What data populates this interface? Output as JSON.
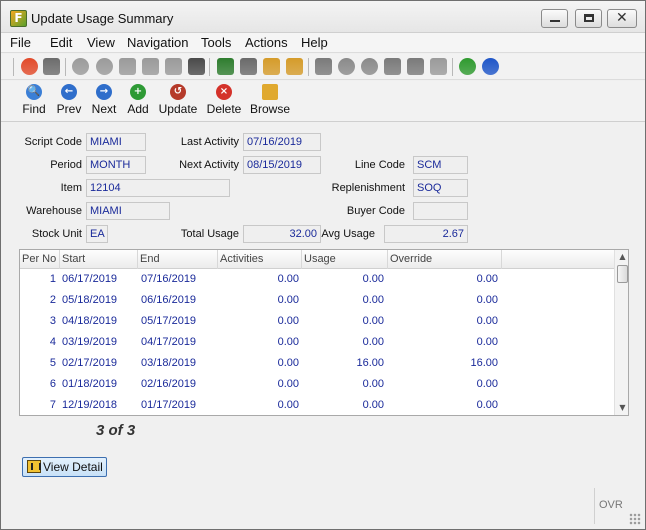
{
  "window": {
    "title": "Update Usage Summary",
    "app_icon_letter": "F"
  },
  "menu": [
    "File",
    "Edit",
    "View",
    "Navigation",
    "Tools",
    "Actions",
    "Help"
  ],
  "toolbar_icons": [
    {
      "name": "power-icon",
      "color": "#e24a2a"
    },
    {
      "name": "print-icon",
      "color": "#6c6c6c"
    },
    {
      "name": "check-icon",
      "color": "#9a9a9a"
    },
    {
      "name": "cancel-icon",
      "color": "#9a9a9a"
    },
    {
      "name": "copy-icon",
      "color": "#9a9a9a"
    },
    {
      "name": "paste-icon",
      "color": "#9a9a9a"
    },
    {
      "name": "select-all-icon",
      "color": "#9a9a9a"
    },
    {
      "name": "zoom-icon",
      "color": "#4a4a4a"
    },
    {
      "name": "notes-icon",
      "color": "#2f7d2f"
    },
    {
      "name": "attachment-icon",
      "color": "#6a6a6a"
    },
    {
      "name": "edit-pencil-icon",
      "color": "#d59b2a"
    },
    {
      "name": "calendar-icon",
      "color": "#d59b2a"
    },
    {
      "name": "upload-icon",
      "color": "#7a7a7a"
    },
    {
      "name": "down-circle-icon",
      "color": "#8a8a8a"
    },
    {
      "name": "up-circle-icon",
      "color": "#8a8a8a"
    },
    {
      "name": "list-up-icon",
      "color": "#7a7a7a"
    },
    {
      "name": "list-down-icon",
      "color": "#7a7a7a"
    },
    {
      "name": "list-clear-icon",
      "color": "#9a9a9a"
    },
    {
      "name": "trend-icon",
      "color": "#2f9a2f"
    },
    {
      "name": "help-icon",
      "color": "#1f56c8"
    }
  ],
  "nav_buttons": [
    {
      "name": "find",
      "label": "Find",
      "icon": "search-icon",
      "color": "#3b7fd6",
      "glyph": "🔍"
    },
    {
      "name": "prev",
      "label": "Prev",
      "icon": "arrow-left-icon",
      "color": "#2f6ecb",
      "glyph": "←"
    },
    {
      "name": "next",
      "label": "Next",
      "icon": "arrow-right-icon",
      "color": "#2f6ecb",
      "glyph": "→"
    },
    {
      "name": "add",
      "label": "Add",
      "icon": "plus-icon",
      "color": "#2e9a35",
      "glyph": "+"
    },
    {
      "name": "update",
      "label": "Update",
      "icon": "refresh-icon",
      "color": "#b53a2a",
      "glyph": "↺"
    },
    {
      "name": "delete",
      "label": "Delete",
      "icon": "delete-x-icon",
      "color": "#d4322a",
      "glyph": "×"
    },
    {
      "name": "browse",
      "label": "Browse",
      "icon": "folder-icon",
      "color": "#e0a92f",
      "glyph": ""
    }
  ],
  "form": {
    "script_code": {
      "label": "Script Code",
      "value": "MIAMI"
    },
    "period": {
      "label": "Period",
      "value": "MONTH"
    },
    "item": {
      "label": "Item",
      "value": "12104"
    },
    "warehouse": {
      "label": "Warehouse",
      "value": "MIAMI"
    },
    "stock_unit": {
      "label": "Stock Unit",
      "value": "EA"
    },
    "last_activity": {
      "label": "Last Activity",
      "value": "07/16/2019"
    },
    "next_activity": {
      "label": "Next Activity",
      "value": "08/15/2019"
    },
    "total_usage": {
      "label": "Total Usage",
      "value": "32.00"
    },
    "line_code": {
      "label": "Line Code",
      "value": "SCM"
    },
    "replenishment": {
      "label": "Replenishment",
      "value": "SOQ"
    },
    "buyer_code": {
      "label": "Buyer Code",
      "value": ""
    },
    "avg_usage": {
      "label": "Avg Usage",
      "value": "2.67"
    }
  },
  "grid": {
    "headers": [
      "Per No",
      "Start",
      "End",
      "Activities",
      "Usage",
      "Override"
    ],
    "rows": [
      [
        "1",
        "06/17/2019",
        "07/16/2019",
        "0.00",
        "0.00",
        "0.00"
      ],
      [
        "2",
        "05/18/2019",
        "06/16/2019",
        "0.00",
        "0.00",
        "0.00"
      ],
      [
        "3",
        "04/18/2019",
        "05/17/2019",
        "0.00",
        "0.00",
        "0.00"
      ],
      [
        "4",
        "03/19/2019",
        "04/17/2019",
        "0.00",
        "0.00",
        "0.00"
      ],
      [
        "5",
        "02/17/2019",
        "03/18/2019",
        "0.00",
        "16.00",
        "16.00"
      ],
      [
        "6",
        "01/18/2019",
        "02/16/2019",
        "0.00",
        "0.00",
        "0.00"
      ],
      [
        "7",
        "12/19/2018",
        "01/17/2019",
        "0.00",
        "0.00",
        "0.00"
      ]
    ]
  },
  "record_count": "3 of 3",
  "view_detail_label": "View Detail",
  "status": {
    "mode": "OVR"
  }
}
